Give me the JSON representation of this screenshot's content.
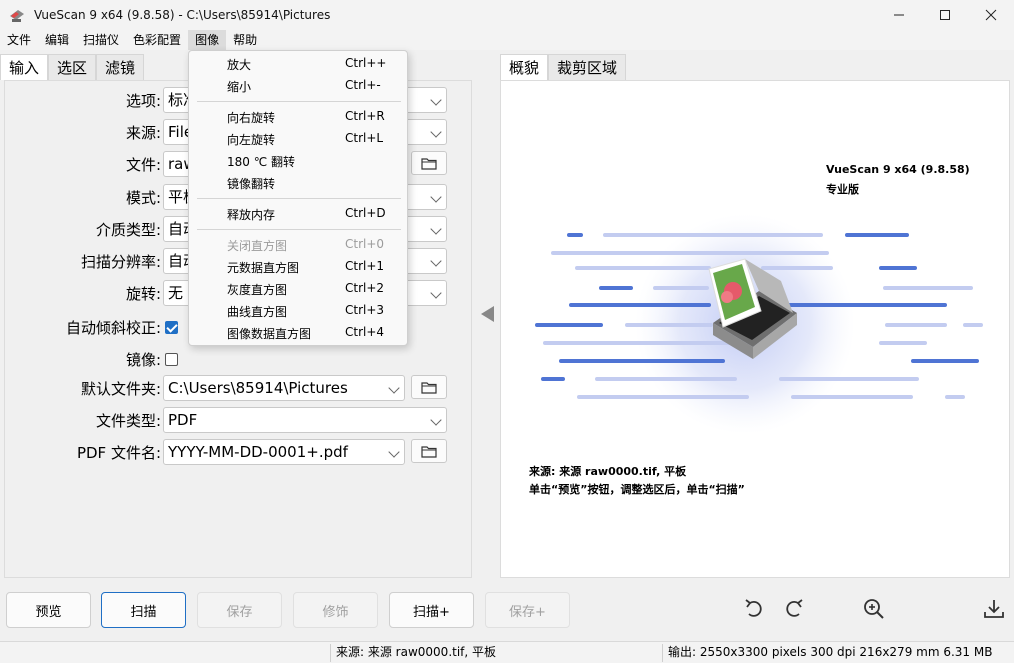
{
  "window": {
    "title": "VueScan 9 x64 (9.8.58) - C:\\Users\\85914\\Pictures"
  },
  "menubar": [
    "文件",
    "编辑",
    "扫描仪",
    "色彩配置",
    "图像",
    "帮助"
  ],
  "left_tabs": [
    "输入",
    "选区",
    "滤镜"
  ],
  "form": {
    "options": {
      "label": "选项:",
      "value": "标准"
    },
    "source": {
      "label": "来源:",
      "value": "File"
    },
    "file": {
      "label": "文件:",
      "value": "raw"
    },
    "mode": {
      "label": "模式:",
      "value": "平板"
    },
    "media_type": {
      "label": "介质类型:",
      "value": "自动"
    },
    "scan_resolution": {
      "label": "扫描分辨率:",
      "value": "自动"
    },
    "rotation": {
      "label": "旋转:",
      "value": "无"
    },
    "auto_deskew": {
      "label": "自动倾斜校正:",
      "checked": true
    },
    "mirror": {
      "label": "镜像:",
      "checked": false
    },
    "default_folder": {
      "label": "默认文件夹:",
      "value": "C:\\Users\\85914\\Pictures"
    },
    "file_type": {
      "label": "文件类型:",
      "value": "PDF"
    },
    "pdf_filename": {
      "label": "PDF 文件名:",
      "value": "YYYY-MM-DD-0001+.pdf"
    }
  },
  "image_menu": {
    "items": [
      {
        "label": "放大",
        "shortcut": "Ctrl++"
      },
      {
        "label": "缩小",
        "shortcut": "Ctrl+-"
      },
      {
        "label": "向右旋转",
        "shortcut": "Ctrl+R"
      },
      {
        "label": "向左旋转",
        "shortcut": "Ctrl+L"
      },
      {
        "label": "180 ℃ 翻转",
        "shortcut": ""
      },
      {
        "label": "镜像翻转",
        "shortcut": ""
      },
      {
        "label": "释放内存",
        "shortcut": "Ctrl+D"
      },
      {
        "label": "关闭直方图",
        "shortcut": "Ctrl+0"
      },
      {
        "label": "元数据直方图",
        "shortcut": "Ctrl+1"
      },
      {
        "label": "灰度直方图",
        "shortcut": "Ctrl+2"
      },
      {
        "label": "曲线直方图",
        "shortcut": "Ctrl+3"
      },
      {
        "label": "图像数据直方图",
        "shortcut": "Ctrl+4"
      }
    ]
  },
  "right_tabs": [
    "概貌",
    "裁剪区域"
  ],
  "overview": {
    "product": "VueScan 9 x64 (9.8.58)",
    "edition": "专业版",
    "source_info": "来源: 来源 raw0000.tif, 平板",
    "hint": "单击“预览”按钮，调整选区后，单击“扫描”"
  },
  "buttons": {
    "preview": "预览",
    "scan": "扫描",
    "save": "保存",
    "retouch": "修饰",
    "scan_plus": "扫描+",
    "save_plus": "保存+"
  },
  "status": {
    "source": "来源: 来源 raw0000.tif, 平板",
    "output": "输出: 2550x3300 pixels 300 dpi 216x279 mm 6.31 MB"
  },
  "colors": {
    "accent": "#1f6fc5",
    "stripe_dark": "#4f74d4",
    "stripe_light": "#c3ccf0"
  }
}
